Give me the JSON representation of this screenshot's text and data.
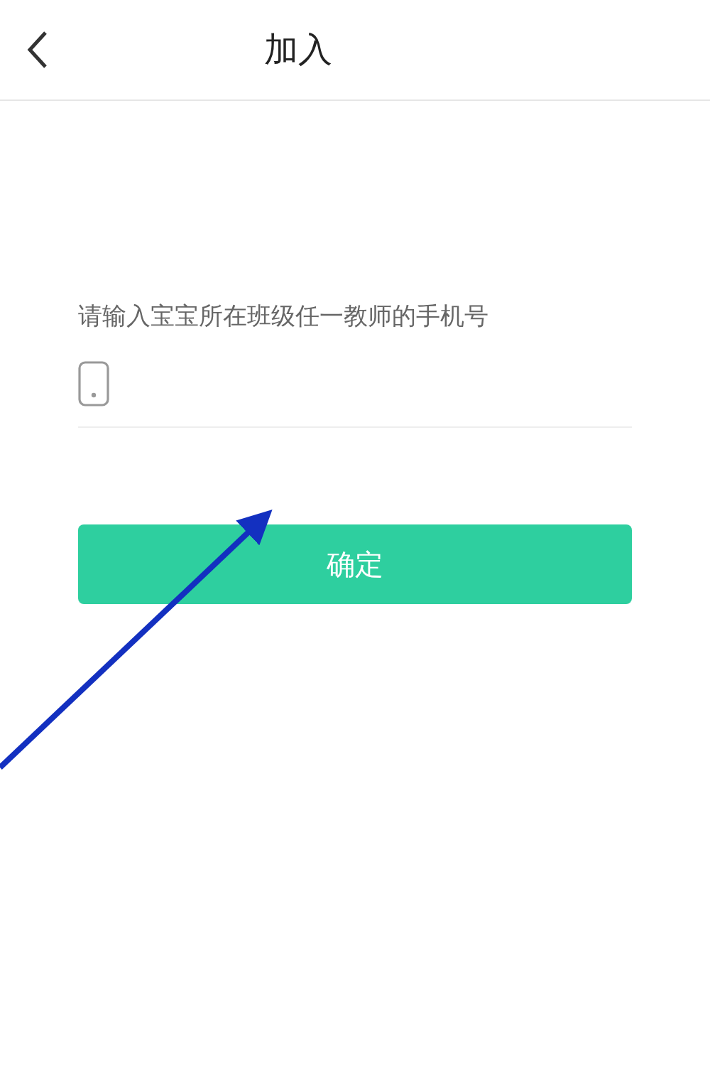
{
  "header": {
    "title": "加入"
  },
  "form": {
    "label": "请输入宝宝所在班级任一教师的手机号"
  },
  "button": {
    "label": "确定"
  }
}
